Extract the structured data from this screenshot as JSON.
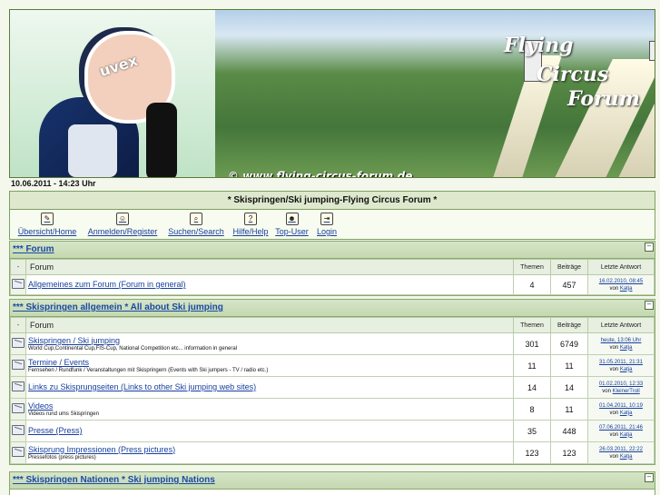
{
  "banner": {
    "title_line1": "Flying",
    "title_line2": "Circus",
    "title_line3": "Forum",
    "helmet_text": "uvex",
    "copyright": "© www.flying-circus-forum.de"
  },
  "date_text": "10.06.2011 - 14:23 Uhr",
  "board_title": "* Skispringen/Ski jumping-Flying Circus Forum *",
  "nav": [
    {
      "label": "Übersicht/Home",
      "icon": "home-icon"
    },
    {
      "label": "Anmelden/Register",
      "icon": "register-icon"
    },
    {
      "label": "Suchen/Search",
      "icon": "search-icon"
    },
    {
      "label": "Hilfe/Help",
      "icon": "help-icon"
    },
    {
      "label": "Top-User",
      "icon": "top-user-icon"
    },
    {
      "label": "Login",
      "icon": "login-icon"
    }
  ],
  "table_headers": {
    "dash": "-",
    "forum": "Forum",
    "themes": "Themen",
    "posts": "Beiträge",
    "last": "Letzte Antwort"
  },
  "sections": [
    {
      "title": "*** Forum",
      "rows": [
        {
          "name": "Allgemeines zum Forum (Forum in general)",
          "desc": "",
          "themes": "4",
          "posts": "457",
          "last_date": "16.02.2010, 08:45",
          "last_prefix": "von ",
          "last_user": "Katja"
        }
      ]
    },
    {
      "title": "*** Skispringen allgemein * All about Ski jumping",
      "rows": [
        {
          "name": "Skispringen / Ski jumping ",
          "desc": "World Cup,Continental Cup,FIS-Cup, National Competition etc... information in general",
          "themes": "301",
          "posts": "6749",
          "last_date": "heute, 13:06 Uhr",
          "last_prefix": "von ",
          "last_user": "Katja"
        },
        {
          "name": "Termine / Events ",
          "desc": "Fernsehen / Rundfunk / Veranstaltungen mit Skispringern (Events with Ski jumpers - TV / radio etc.)",
          "themes": "11",
          "posts": "11",
          "last_date": "31.05.2011, 21:31",
          "last_prefix": "von ",
          "last_user": "Katja"
        },
        {
          "name": "Links zu Skisprungseiten (Links to other Ski jumping web sites)",
          "desc": "",
          "themes": "14",
          "posts": "14",
          "last_date": "01.02.2010, 12:33",
          "last_prefix": "von ",
          "last_user": "KleinerTroll"
        },
        {
          "name": "Videos",
          "desc": "Videos rund ums Skispringen",
          "themes": "8",
          "posts": "11",
          "last_date": "01.04.2011, 10:19",
          "last_prefix": "von ",
          "last_user": "Katja"
        },
        {
          "name": "Presse (Press)",
          "desc": "",
          "themes": "35",
          "posts": "448",
          "last_date": "07.06.2011, 21:46",
          "last_prefix": "von ",
          "last_user": "Katja"
        },
        {
          "name": "Skisprung Impressionen (Press pictures)",
          "desc": "Pressefotos (press pictures)",
          "themes": "123",
          "posts": "123",
          "last_date": "26.03.2011, 22:22",
          "last_prefix": "von ",
          "last_user": "Katja"
        }
      ]
    },
    {
      "title": "*** Skispringen Nationen * Ski jumping Nations",
      "rows": []
    }
  ]
}
